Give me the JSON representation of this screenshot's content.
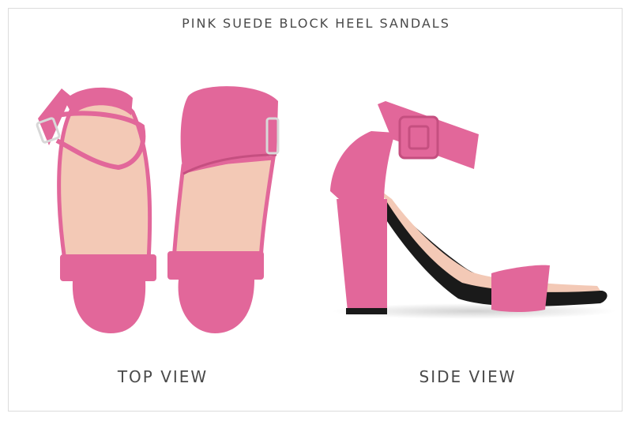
{
  "title": "PINK SUEDE BLOCK HEEL SANDALS",
  "captions": {
    "top_view": "TOP VIEW",
    "side_view": "SIDE VIEW"
  },
  "colors": {
    "suede": "#e2679a",
    "suede_dark": "#c54f80",
    "lining": "#f3c9b6",
    "sole": "#1a1a1a",
    "buckle": "#d8d8d8"
  }
}
